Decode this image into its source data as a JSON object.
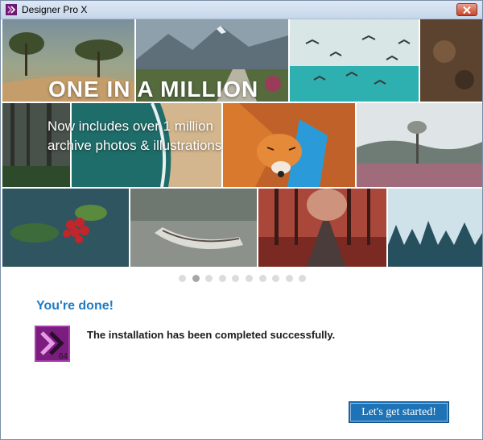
{
  "window": {
    "title": "Designer Pro X",
    "accent": "#1e73b6",
    "title_color": "#1e7bc4"
  },
  "banner": {
    "headline": "ONE IN A MILLION",
    "subline_1": "Now includes over 1 million",
    "subline_2": "archive photos & illustrations"
  },
  "carousel": {
    "total": 10,
    "active_index": 1
  },
  "status": {
    "title": "You're done!",
    "message": "The installation has been completed successfully.",
    "product_badge": "64"
  },
  "actions": {
    "start_label": "Let's get started!"
  },
  "icons": {
    "app": "designer-app-icon",
    "close": "close-icon",
    "product": "designer-product-icon"
  }
}
